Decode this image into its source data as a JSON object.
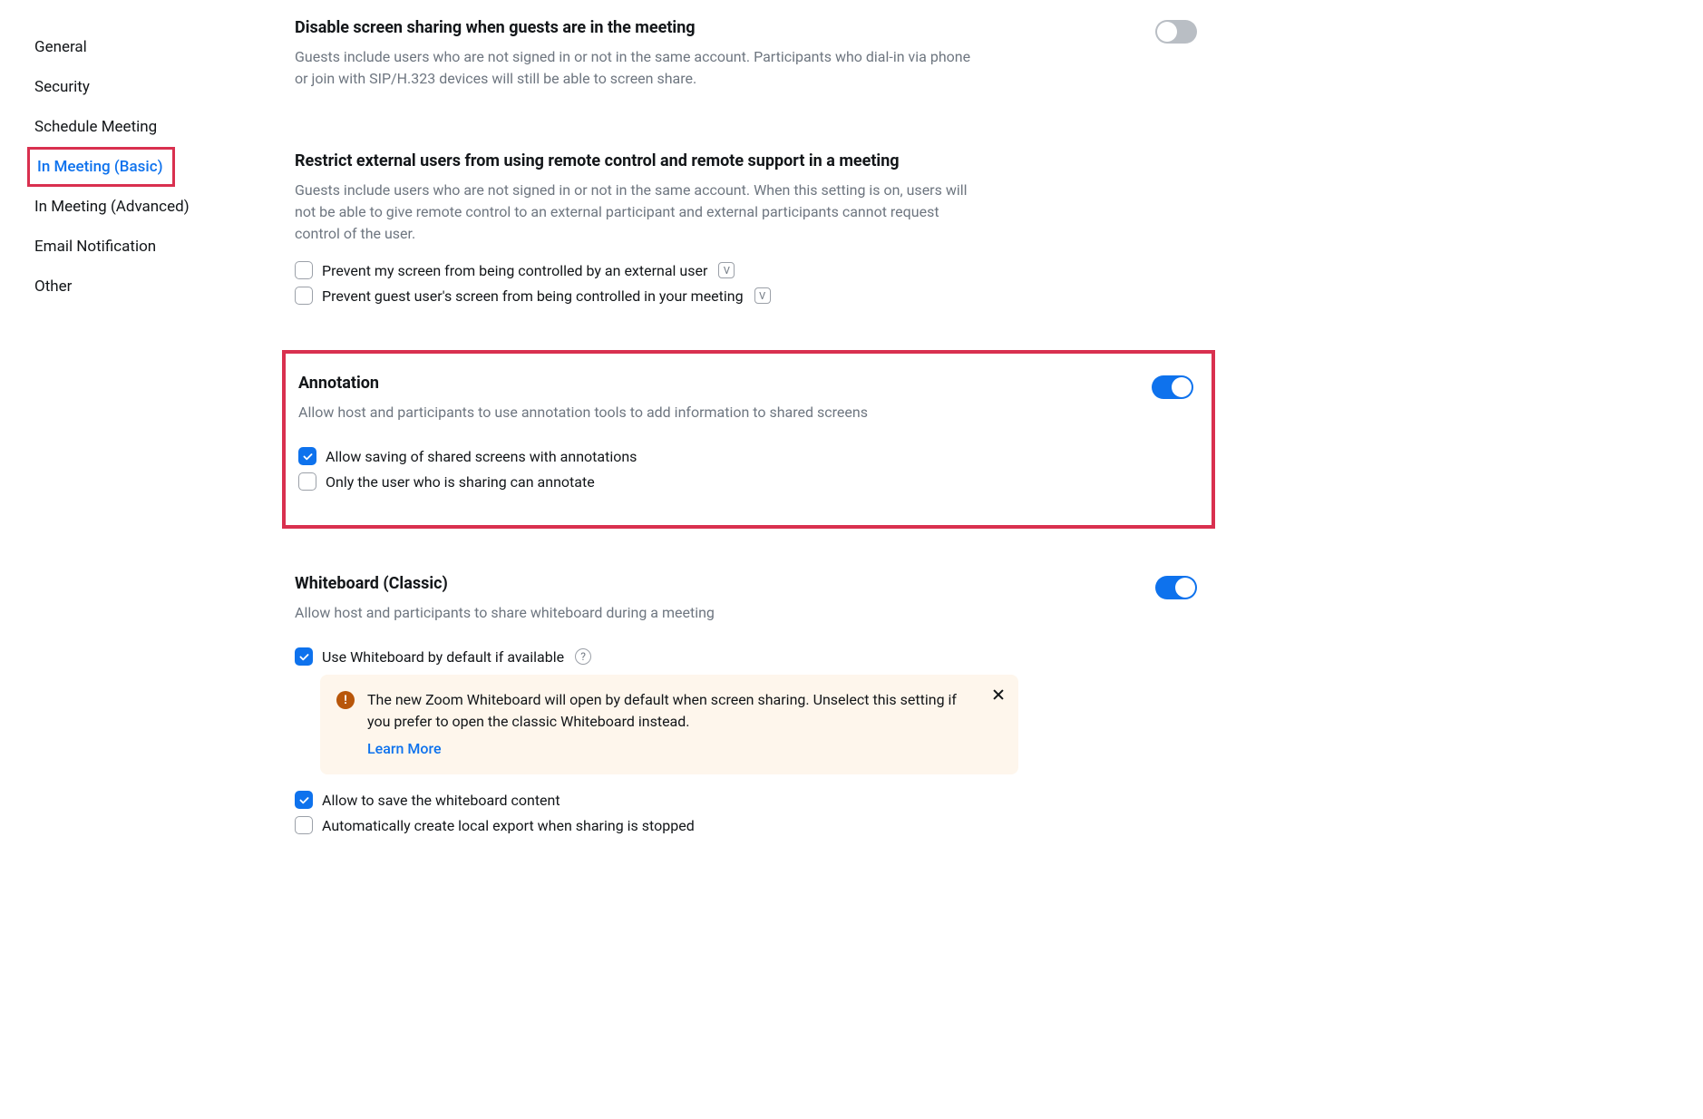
{
  "sidebar": {
    "items": [
      {
        "label": "General"
      },
      {
        "label": "Security"
      },
      {
        "label": "Schedule Meeting"
      },
      {
        "label": "In Meeting (Basic)"
      },
      {
        "label": "In Meeting (Advanced)"
      },
      {
        "label": "Email Notification"
      },
      {
        "label": "Other"
      }
    ]
  },
  "sections": {
    "disableScreenShare": {
      "title": "Disable screen sharing when guests are in the meeting",
      "desc": "Guests include users who are not signed in or not in the same account. Participants who dial-in via phone or join with SIP/H.323 devices will still be able to screen share."
    },
    "restrictRemote": {
      "title": "Restrict external users from using remote control and remote support in a meeting",
      "desc": "Guests include users who are not signed in or not in the same account. When this setting is on, users will not be able to give remote control to an external participant and external participants cannot request control of the user.",
      "opt1": "Prevent my screen from being controlled by an external user",
      "opt2": "Prevent guest user's screen from being controlled in your meeting"
    },
    "annotation": {
      "title": "Annotation",
      "desc": "Allow host and participants to use annotation tools to add information to shared screens",
      "opt1": "Allow saving of shared screens with annotations",
      "opt2": "Only the user who is sharing can annotate"
    },
    "whiteboard": {
      "title": "Whiteboard (Classic)",
      "desc": "Allow host and participants to share whiteboard during a meeting",
      "opt1": "Use Whiteboard by default if available",
      "noticeText": "The new Zoom Whiteboard will open by default when screen sharing. Unselect this setting if you prefer to open the classic Whiteboard instead.",
      "noticeLink": "Learn More",
      "opt2": "Allow to save the whiteboard content",
      "opt3": "Automatically create local export when sharing is stopped"
    }
  },
  "icons": {
    "v": "V",
    "q": "?",
    "bang": "!"
  }
}
